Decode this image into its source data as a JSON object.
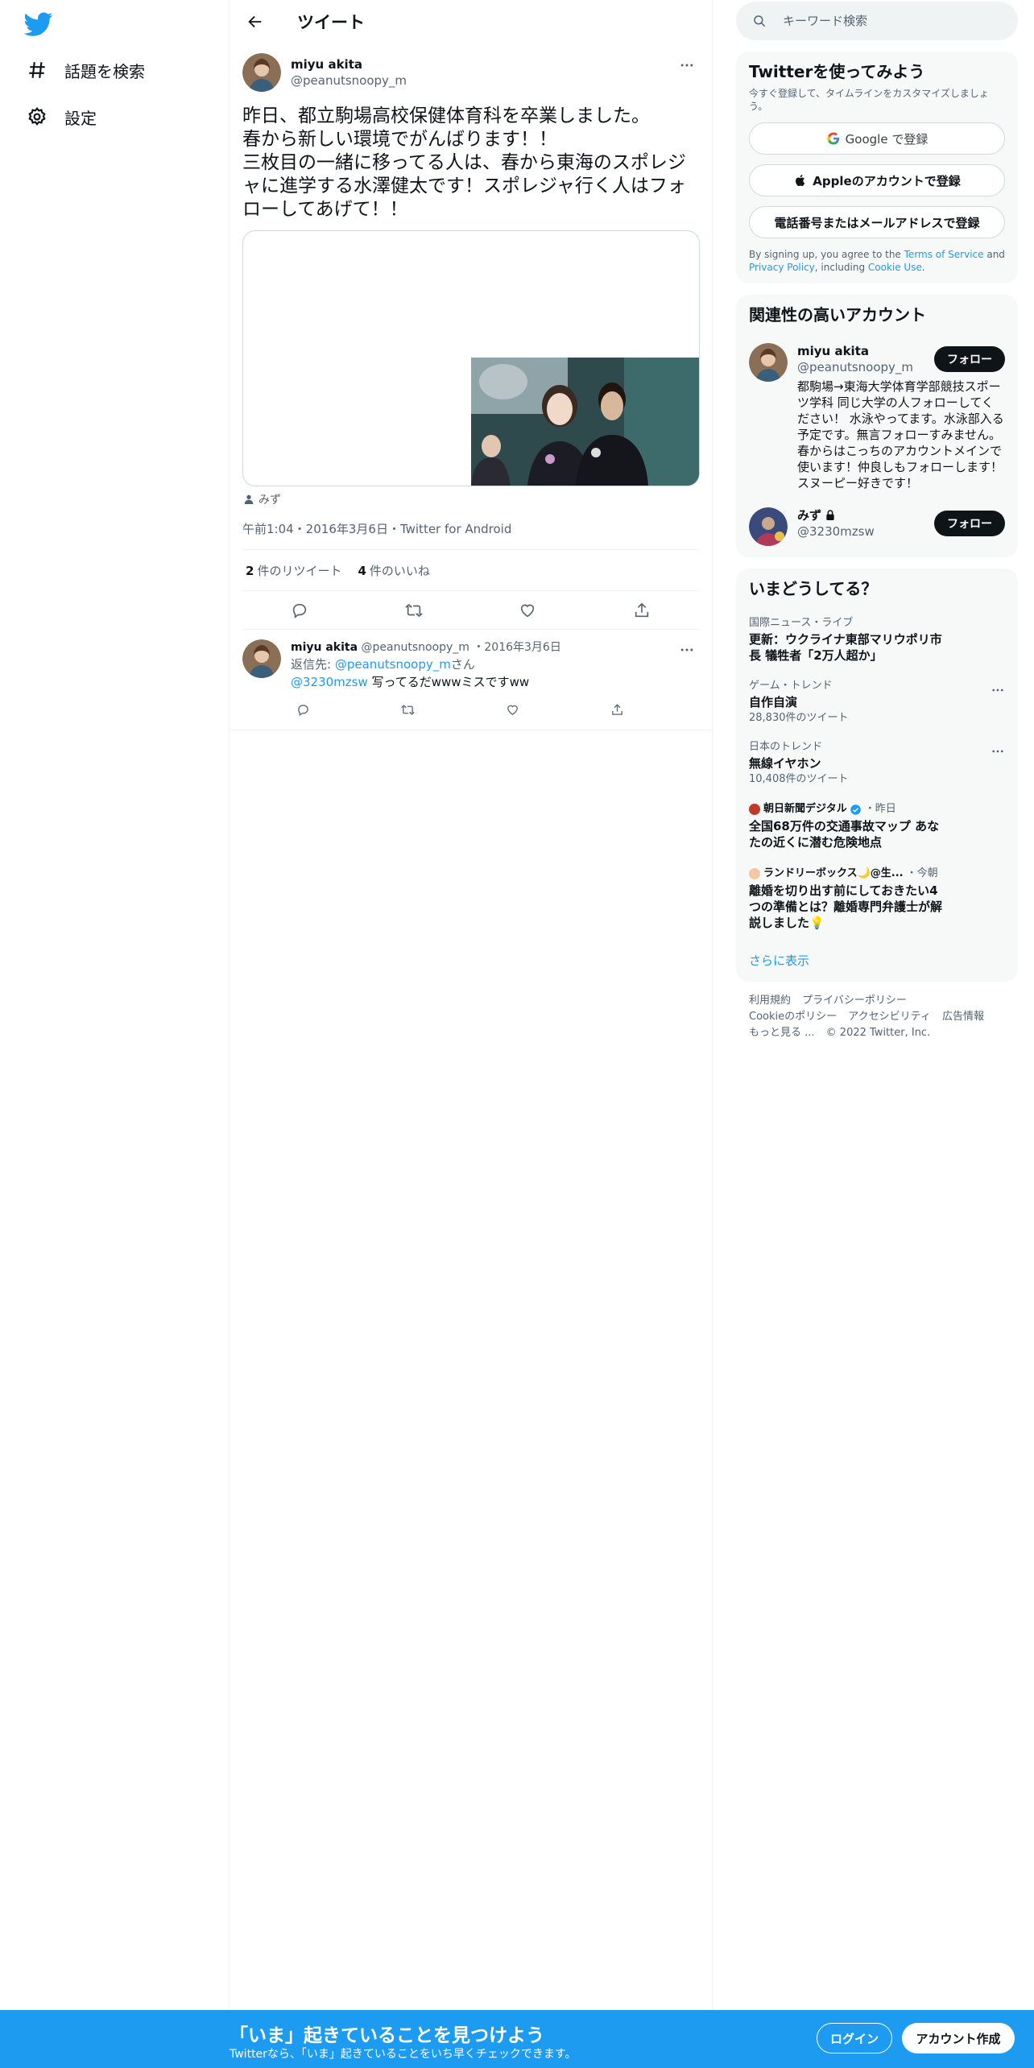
{
  "nav": {
    "explore_label": "話題を検索",
    "settings_label": "設定"
  },
  "header": {
    "title": "ツイート"
  },
  "tweet": {
    "author_name": "miyu akita",
    "author_handle": "@peanutsnoopy_m",
    "text_lines": [
      "昨日、都立駒場高校保健体育科を卒業しました。",
      "春から新しい環境でがんばります！！",
      "三枚目の一緒に移ってる人は、春から東海のスポレジャに進学する水澤健太です！スポレジャ行く人はフォローしてあげて！！"
    ],
    "tagged_user": "みず",
    "meta": "午前1:04・2016年3月6日・Twitter for Android",
    "retweets_count": "2",
    "retweets_label": "件のリツイート",
    "likes_count": "4",
    "likes_label": "件のいいね"
  },
  "reply": {
    "author_name": "miyu akita",
    "author_handle": "@peanutsnoopy_m",
    "date": "・2016年3月6日",
    "reply_to_prefix": "返信先: ",
    "reply_to_handle": "@peanutsnoopy_m",
    "reply_to_suffix": "さん",
    "mention": "@3230mzsw",
    "text": " 写ってるだwwwミスですww"
  },
  "search": {
    "placeholder": "キーワード検索"
  },
  "signup": {
    "title": "Twitterを使ってみよう",
    "subtitle": "今すぐ登録して、タイムラインをカスタマイズしましょう。",
    "google_label": "Google で登録",
    "apple_label": "Appleのアカウントで登録",
    "phone_label": "電話番号またはメールアドレスで登録",
    "terms_prefix": "By signing up, you agree to the ",
    "terms_link": "Terms of Service",
    "terms_and": " and ",
    "privacy_link": "Privacy Policy",
    "terms_including": ", including ",
    "cookie_link": "Cookie Use",
    "terms_end": "."
  },
  "related": {
    "title": "関連性の高いアカウント",
    "accounts": [
      {
        "name": "miyu akita",
        "handle": "@peanutsnoopy_m",
        "bio": "都駒場→東海大学体育学部競技スポーツ学科 同じ大学の人フォローしてください！ 水泳やってます。水泳部入る予定です。無言フォローすみません。春からはこっちのアカウントメインで使います！仲良しもフォローします！スヌーピー好きです！",
        "follow_label": "フォロー"
      },
      {
        "name": "みず",
        "handle": "@3230mzsw",
        "follow_label": "フォロー"
      }
    ]
  },
  "trends": {
    "title": "いまどうしてる？",
    "items": [
      {
        "meta": "国際ニュース・ライブ",
        "title": "更新：ウクライナ東部マリウポリ市長 犠牲者「2万人超か」"
      },
      {
        "meta": "ゲーム・トレンド",
        "title": "自作自演",
        "count": "28,830件のツイート"
      },
      {
        "meta": "日本のトレンド",
        "title": "無線イヤホン",
        "count": "10,408件のツイート"
      }
    ],
    "news": [
      {
        "source": "朝日新聞デジタル",
        "time": "・昨日",
        "title": "全国68万件の交通事故マップ あなたの近くに潜む危険地点"
      },
      {
        "source": "ランドリーボックス🌙@生...",
        "time": "・今朝",
        "title": "離婚を切り出す前にしておきたい4つの準備とは？離婚専門弁護士が解説しました💡"
      }
    ],
    "show_more": "さらに表示"
  },
  "footer": {
    "terms": "利用規約",
    "privacy": "プライバシーポリシー",
    "cookie": "Cookieのポリシー",
    "accessibility": "アクセシビリティ",
    "ads": "広告情報",
    "more": "もっと見る ...",
    "copyright": "© 2022 Twitter, Inc."
  },
  "banner": {
    "title": "「いま」起きていることを見つけよう",
    "subtitle": "Twitterなら、「いま」起きていることをいち早くチェックできます。",
    "login_label": "ログイン",
    "signup_label": "アカウント作成"
  },
  "colors": {
    "accent": "#1d9bf0",
    "text": "#0f1419",
    "muted": "#536471",
    "border": "#eff3f4"
  }
}
